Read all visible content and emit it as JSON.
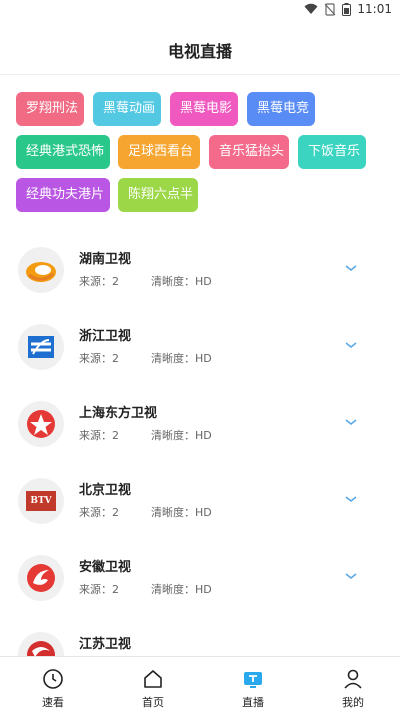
{
  "status_bar": {
    "time": "11:01"
  },
  "header": {
    "title": "电视直播"
  },
  "tags": [
    {
      "label": "罗翔刑法",
      "color": "#f26b84"
    },
    {
      "label": "黑莓动画",
      "color": "#52c8e3"
    },
    {
      "label": "黑莓电影",
      "color": "#ef59c0"
    },
    {
      "label": "黑莓电竞",
      "color": "#5a8cf5"
    },
    {
      "label": "经典港式恐怖",
      "color": "#2ac78b"
    },
    {
      "label": "足球西看台",
      "color": "#f5a530"
    },
    {
      "label": "音乐猛抬头",
      "color": "#f36a8b"
    },
    {
      "label": "下饭音乐",
      "color": "#3bd4c0"
    },
    {
      "label": "经典功夫港片",
      "color": "#b957e4"
    },
    {
      "label": "陈翔六点半",
      "color": "#9bd746"
    }
  ],
  "channels": [
    {
      "name": "湖南卫视",
      "source": "来源：2",
      "quality": "清晰度：HD",
      "logo": "hunan-logo"
    },
    {
      "name": "浙江卫视",
      "source": "来源：2",
      "quality": "清晰度：HD",
      "logo": "zhejiang-logo"
    },
    {
      "name": "上海东方卫视",
      "source": "来源：2",
      "quality": "清晰度：HD",
      "logo": "dragon-tv-logo"
    },
    {
      "name": "北京卫视",
      "source": "来源：2",
      "quality": "清晰度：HD",
      "logo": "btv-logo",
      "logo_text": "BTV"
    },
    {
      "name": "安徽卫视",
      "source": "来源：2",
      "quality": "清晰度：HD",
      "logo": "anhui-logo"
    },
    {
      "name": "江苏卫视",
      "source": "",
      "quality": "",
      "logo": "jiangsu-logo"
    }
  ],
  "bottom_nav": [
    {
      "label": "速看",
      "icon": "clock-icon",
      "active": false
    },
    {
      "label": "首页",
      "icon": "home-icon",
      "active": false
    },
    {
      "label": "直播",
      "icon": "tv-icon",
      "active": true
    },
    {
      "label": "我的",
      "icon": "user-icon",
      "active": false
    }
  ],
  "colors": {
    "accent": "#2aa8ee",
    "chevron": "#5aa9e6"
  }
}
